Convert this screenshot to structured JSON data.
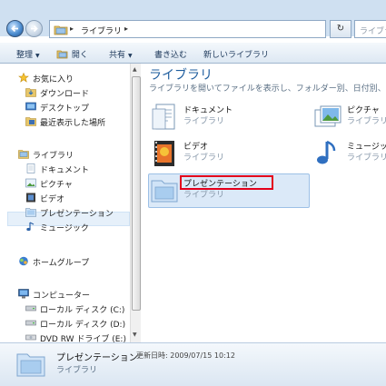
{
  "address": {
    "path_label": "ライブラリ",
    "search_placeholder": "ライブラリ"
  },
  "toolbar": {
    "organize": "整理",
    "open": "開く",
    "share": "共有",
    "burn": "書き込む",
    "new_library": "新しいライブラリ"
  },
  "navpane": {
    "favorites": "お気に入り",
    "downloads": "ダウンロード",
    "desktop": "デスクトップ",
    "recent": "最近表示した場所",
    "libraries": "ライブラリ",
    "documents": "ドキュメント",
    "pictures": "ピクチャ",
    "videos": "ビデオ",
    "presentation": "プレゼンテーション",
    "music": "ミュージック",
    "homegroup": "ホームグループ",
    "computer": "コンピューター",
    "disk_c": "ローカル ディスク (C:)",
    "disk_d": "ローカル ディスク (D:)",
    "dvd_e": "DVD RW ドライブ (E:)"
  },
  "content": {
    "heading": "ライブラリ",
    "subheading": "ライブラリを開いてファイルを表示し、フォルダー別、日付別、また",
    "libraries": [
      {
        "name": "ドキュメント",
        "type": "ライブラリ"
      },
      {
        "name": "ピクチャ",
        "type": "ライブラリ"
      },
      {
        "name": "ビデオ",
        "type": "ライブラリ"
      },
      {
        "name": "ミュージック",
        "type": "ライブラリ"
      },
      {
        "name": "プレゼンテーション",
        "type": "ライブラリ"
      }
    ]
  },
  "details": {
    "name": "プレゼンテーション",
    "modified": "更新日時: 2009/07/15 10:12",
    "type": "ライブラリ"
  },
  "colors": {
    "highlight": "#e3001b",
    "accent": "#1e5d9e"
  }
}
